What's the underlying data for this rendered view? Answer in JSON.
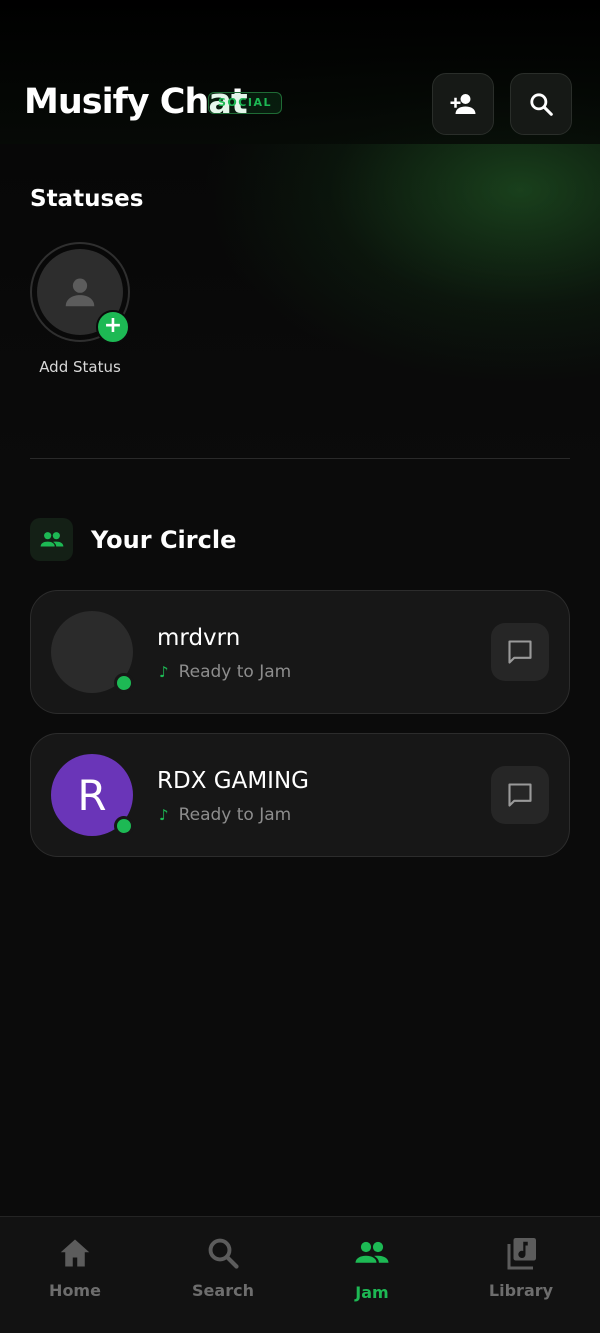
{
  "header": {
    "title": "Musify Chat",
    "badge": "SOCIAL",
    "add_friend_icon": "person-add-icon",
    "search_icon": "search-icon"
  },
  "statuses": {
    "title": "Statuses",
    "add_status_label": "Add Status"
  },
  "circle": {
    "title": "Your Circle",
    "friends": [
      {
        "name": "mrdvrn",
        "status": "Ready to Jam",
        "initial": "",
        "avatar_color": "#2b2b2b",
        "online": true
      },
      {
        "name": "RDX GAMING",
        "status": "Ready to Jam",
        "initial": "R",
        "avatar_color": "#6a35b8",
        "online": true
      }
    ]
  },
  "tabs": [
    {
      "label": "Home",
      "icon": "home-icon",
      "active": false
    },
    {
      "label": "Search",
      "icon": "search-icon",
      "active": false
    },
    {
      "label": "Jam",
      "icon": "group-icon",
      "active": true
    },
    {
      "label": "Library",
      "icon": "library-music-icon",
      "active": false
    }
  ],
  "colors": {
    "accent": "#1db954",
    "background": "#0b0b0b",
    "card": "#171717"
  }
}
